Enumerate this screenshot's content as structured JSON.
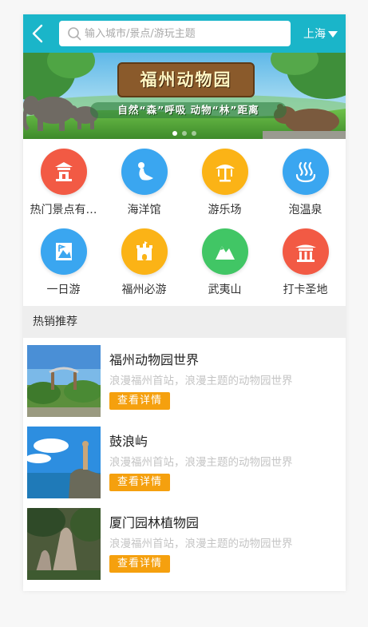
{
  "header": {
    "back_icon": "chevron-left-icon",
    "search_placeholder": "输入城市/景点/游玩主题",
    "search_icon": "search-icon",
    "city": "上海",
    "city_icon": "caret-down-icon",
    "bg_color": "#1ab5c9"
  },
  "banner": {
    "title": "福州动物园",
    "subtitle": "自然“森”呼吸  动物“林”距离",
    "active_slide": 1,
    "slide_count": 3
  },
  "categories": [
    {
      "label": "热门景点有…",
      "icon": "pagoda-icon",
      "color": "#f25a44"
    },
    {
      "label": "海洋馆",
      "icon": "seal-icon",
      "color": "#3aa6f0"
    },
    {
      "label": "游乐场",
      "icon": "carousel-icon",
      "color": "#fbb316"
    },
    {
      "label": "泡温泉",
      "icon": "hot-spring-icon",
      "color": "#3aa6f0"
    },
    {
      "label": "一日游",
      "icon": "map-flag-icon",
      "color": "#3aa6f0"
    },
    {
      "label": "福州必游",
      "icon": "castle-icon",
      "color": "#fbb316"
    },
    {
      "label": "武夷山",
      "icon": "mountain-icon",
      "color": "#41c665"
    },
    {
      "label": "打卡圣地",
      "icon": "temple-icon",
      "color": "#f25a44"
    }
  ],
  "section": {
    "title": "热销推荐"
  },
  "items": [
    {
      "title": "福州动物园世界",
      "desc": "浪漫福州首站，浪漫主题的动物园世界",
      "button": "查看详情"
    },
    {
      "title": "鼓浪屿",
      "desc": "浪漫福州首站，浪漫主题的动物园世界",
      "button": "查看详情"
    },
    {
      "title": "厦门园林植物园",
      "desc": "浪漫福州首站，浪漫主题的动物园世界",
      "button": "查看详情"
    }
  ],
  "colors": {
    "accent_button": "#f5a00e",
    "desc_text": "#c4c4c4"
  }
}
